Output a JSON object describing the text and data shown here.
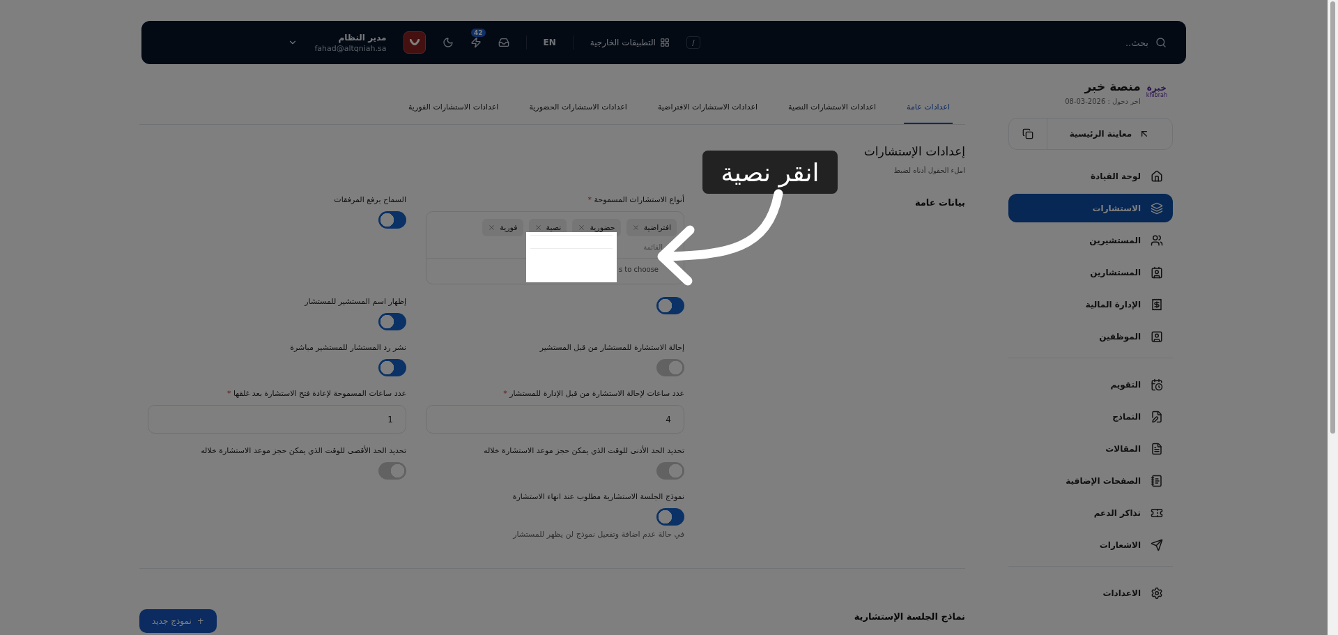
{
  "topbar": {
    "search_placeholder": "بحث..",
    "search_shortcut": "/",
    "apps_label": "التطبيقات الخارجية",
    "language": "EN",
    "notifications_count": "42",
    "user": {
      "name": "مدير النظام",
      "email": "fahad@altqniah.sa"
    }
  },
  "sidebar": {
    "brand": {
      "logo_text": "خبرة",
      "logo_subtext": "khibrah",
      "title": "منصة خبر",
      "last_login": "اخر دخول : 2026-03-08"
    },
    "preview_button": "معاينة الرئيسية",
    "groups": [
      [
        {
          "label": "لوحة القيادة",
          "selected": false
        },
        {
          "label": "الاستشارات",
          "selected": true
        },
        {
          "label": "المستشيرين",
          "selected": false
        },
        {
          "label": "المستشارين",
          "selected": false
        },
        {
          "label": "الإدارة المالية",
          "selected": false
        },
        {
          "label": "الموظفين",
          "selected": false
        }
      ],
      [
        {
          "label": "التقويم",
          "selected": false
        },
        {
          "label": "النماذج",
          "selected": false
        },
        {
          "label": "المقالات",
          "selected": false
        },
        {
          "label": "الصفحات الإضافية",
          "selected": false
        },
        {
          "label": "تذاكر الدعم",
          "selected": false
        },
        {
          "label": "الاشعارات",
          "selected": false
        }
      ],
      [
        {
          "label": "الاعدادات",
          "selected": false
        }
      ]
    ]
  },
  "tabs": [
    {
      "label": "اعدادات عامة",
      "selected": true
    },
    {
      "label": "اعدادات الاستشارات النصية",
      "selected": false
    },
    {
      "label": "اعدادات الاستشارات الافتراضية",
      "selected": false
    },
    {
      "label": "اعدادات الاستشارات الحضورية",
      "selected": false
    },
    {
      "label": "اعدادات الاستشارات الفورية",
      "selected": false
    }
  ],
  "page": {
    "title": "إعدادات الإستشارات",
    "subtitle": "املء الحقول أدناه لضبط",
    "section": "بيانات عامة"
  },
  "form": {
    "rows": [
      {
        "cells": [
          {
            "kind": "multiselect",
            "label": "أنواع الاستشارات المسموحة",
            "required_mark": "*",
            "tags": [
              "افتراضية",
              "حضورية",
              "نصية",
              "فورية"
            ],
            "placeholder": "القائمة",
            "hint": "s to choose"
          },
          {
            "kind": "toggle",
            "label": "السماح برفع المرفقات",
            "on": true
          }
        ]
      },
      {
        "cells": [
          {
            "kind": "toggle",
            "on": true
          },
          {
            "kind": "toggle",
            "label": "إظهار اسم المستشير للمستشار",
            "on": true
          }
        ]
      },
      {
        "cells": [
          {
            "kind": "toggle",
            "label": "إحالة الاستشارة للمستشار من قبل المستشير",
            "on": false
          },
          {
            "kind": "toggle",
            "label": "نشر رد المستشار للمستشير مباشرة",
            "on": true
          }
        ]
      },
      {
        "cells": [
          {
            "kind": "input",
            "label": "عدد ساعات لإحالة الاستشارة من قبل الإدارة للمستشار",
            "required_mark": "*",
            "value": "4"
          },
          {
            "kind": "input",
            "label": "عدد ساعات المسموحة لإعادة فتح الاستشارة بعد غلقها",
            "required_mark": "*",
            "value": "1"
          }
        ]
      },
      {
        "cells": [
          {
            "kind": "toggle",
            "label": "تحديد الحد الأدنى للوقت الذي يمكن حجز موعد الاستشارة خلاله",
            "on": false
          },
          {
            "kind": "toggle",
            "label": "تحديد الحد الأقصى للوقت الذي يمكن حجز موعد الاستشارة خلاله",
            "on": false
          }
        ]
      },
      {
        "cells": [
          {
            "kind": "toggle",
            "label": "نموذج الجلسة الاستشارية مطلوب عند انهاء الاستشارة",
            "on": true,
            "hint": "في حالة عدم اضافة وتفعيل نموذج لن يظهر للمستشار"
          }
        ]
      }
    ]
  },
  "templates": {
    "title": "نماذج الجلسة الإستشارية",
    "new_button": "نموذج جديد",
    "button_icon": "+"
  },
  "tutorial": {
    "callout": "انقر نصية"
  }
}
